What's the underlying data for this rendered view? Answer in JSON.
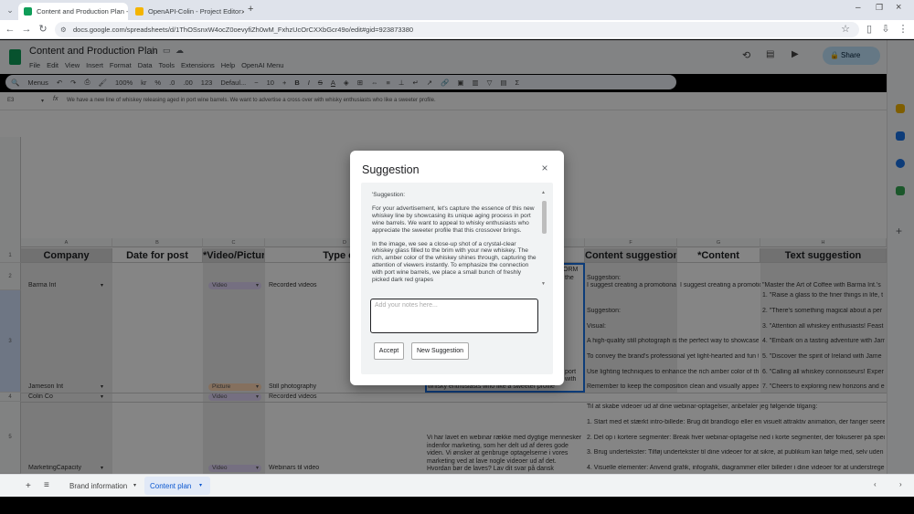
{
  "browser": {
    "tabs": [
      {
        "title": "Content and Production Plan - ",
        "active": true,
        "favicon": "sheets-icon"
      },
      {
        "title": "OpenAPI-Colin - Project Editor",
        "active": false,
        "favicon": "apps-script-icon"
      }
    ],
    "new_tab": "+",
    "url": "docs.google.com/spreadsheets/d/1ThOSsnxW4ocZ0oevyfiZh0wM_FxhzUcOrCXXbGcr49o/edit#gid=923873380"
  },
  "sheet": {
    "title": "Content and Production Plan",
    "menus": [
      "File",
      "Edit",
      "View",
      "Insert",
      "Format",
      "Data",
      "Tools",
      "Extensions",
      "Help",
      "OpenAI Menu"
    ],
    "share_label": "Share",
    "toolbar": {
      "menus_label": "Menus",
      "zoom": "100%",
      "currency": "kr",
      "percent": "%",
      "dec1": ".0",
      "dec2": ".00",
      "numfmt": "123",
      "font": "Defaul...",
      "font_size": "10"
    },
    "name_box": "E3",
    "formula": "We have a new line of whiskey releasing aged in port wine barrels. We want to advertise a cross over with whisky enthusiasts who like a sweeter profile."
  },
  "grid": {
    "column_letters": [
      "A",
      "B",
      "C",
      "D",
      "E",
      "F",
      "G",
      "H"
    ],
    "row_numbers": [
      "1",
      "2",
      "3",
      "4",
      "5"
    ],
    "headers": {
      "A": "Company",
      "B": "Date for post",
      "C": "*Video/Picture",
      "D": "Type of c",
      "F": "Content suggestion",
      "G": "*Content",
      "H": "Text suggestion"
    },
    "rows": [
      {
        "company": "Barma Int",
        "type": "Video",
        "content": "Recorded videos"
      },
      {
        "company": "Jameson Int",
        "type": "Picture",
        "content": "Still photography"
      },
      {
        "company": "Colin Co",
        "type": "Video",
        "content": "Recorded videos"
      },
      {
        "company": "MarketingCapacity",
        "type": "Video",
        "content": "Webinars til video"
      }
    ],
    "col_e_snips": [
      "ORM",
      "the",
      "port",
      "with",
      "whisky enthusiasts who like a sweeter profile"
    ],
    "col_e_danish": "Vi har lavet en webinar række med dygtige mennesker indenfor marketing, som her delt ud af deres gode viden. Vi ønsker at genbruge optagelserne i vores marketing ved at lave nogle videoer ud af det. Hvordan bør de laves? Lav dit svar på dansk",
    "col_f_lines": [
      "Suggestion:",
      "I suggest creating a promotional",
      "Suggestion:",
      "Visual:",
      "A high-quality still photograph is the perfect way to showcase",
      "To convey the brand's professional yet light-hearted and fun to",
      "Use lighting techniques to enhance the rich amber color of the",
      "Remember to keep the composition clean and visually appeal"
    ],
    "col_g_line": "I suggest creating a promotional",
    "col_h_lines": [
      "\"Master the Art of Coffee with Barma Int.'s",
      "1. \"Raise a glass to the finer things in life, t",
      "2. \"There's something magical about a per",
      "3. \"Attention all whiskey enthusiasts! Feast",
      "4. \"Embark on a tasting adventure with Jam",
      "5. \"Discover the spirit of Ireland with Jame",
      "6. \"Calling all whiskey connoisseurs! Exper",
      "7. \"Cheers to exploring new horizons and e"
    ],
    "danish_lines": [
      "Til at skabe videoer ud af dine webinar-optagelser, anbefaler jeg følgende tilgang:",
      "1. Start med et stærkt intro-billede: Brug dit brandlogo eller en visuelt attraktiv animation, der fanger seere",
      "2. Del op i kortere segmenter: Break hver webinar-optagelse ned i korte segmenter, der fokuserer på spec",
      "3. Brug undertekster: Tilføj undertekster til dine videoer for at sikre, at publikum kan følge med, selv uden",
      "4. Visuelle elementer: Anvend grafik, infografik, diagrammer eller billeder i dine videoer for at understrege"
    ]
  },
  "bottom": {
    "add": "+",
    "all_sheets": "≡",
    "sheet_tabs": [
      "Brand information",
      "Content plan"
    ],
    "active_tab": "Content plan"
  },
  "dialog": {
    "title": "Suggestion",
    "close_glyph": "×",
    "suggestion_label": "'Suggestion:",
    "paragraphs": [
      "For your advertisement, let's capture the essence of this new whiskey line by showcasing its unique aging process in port wine barrels. We want to appeal to whisky enthusiasts who appreciate the sweeter profile that this crossover brings.",
      "In the image, we see a close-up shot of a crystal-clear whiskey glass filled to the brim with your new whiskey. The rich, amber color of the whiskey shines through, capturing the attention of viewers instantly. To emphasize the connection with port wine barrels, we place a small bunch of freshly picked dark red grapes"
    ],
    "notes_placeholder": "Add your notes here...",
    "accept_label": "Accept",
    "new_suggestion_label": "New Suggestion"
  },
  "colors": {
    "accent": "#1a73e8",
    "sheets_green": "#0f9d58",
    "share_bg": "#c2e7ff",
    "header_gray": "#cccccc",
    "video_chip": "#e1d5f7",
    "picture_chip": "#ffd7b5"
  }
}
